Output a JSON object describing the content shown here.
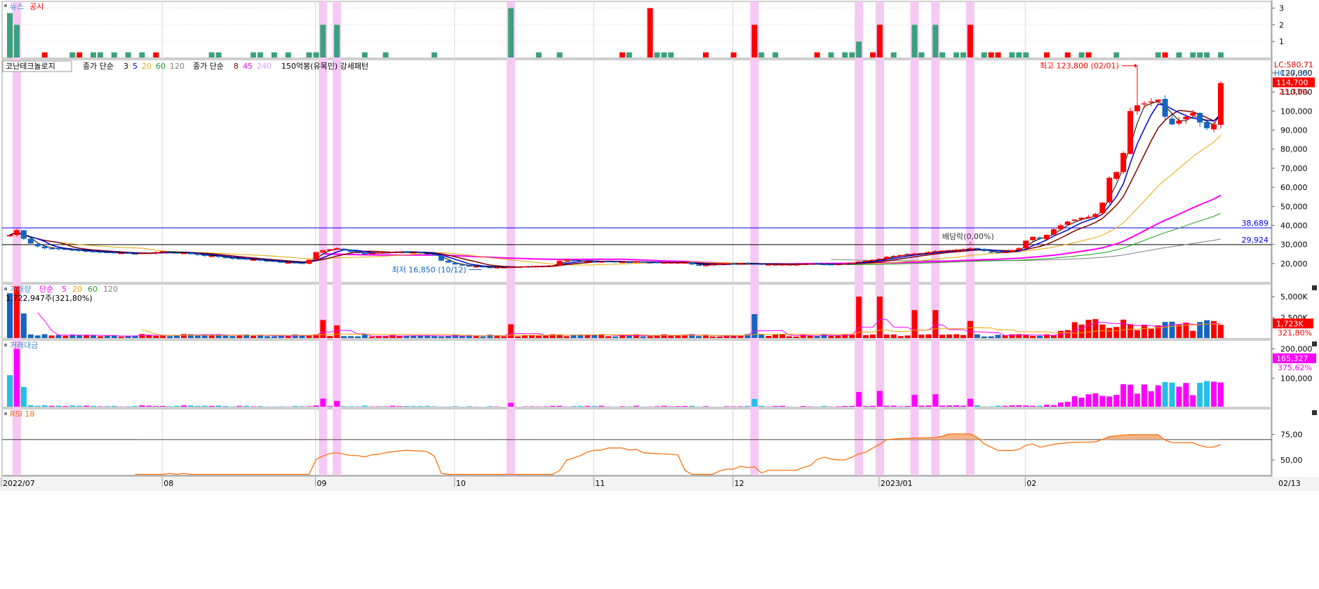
{
  "colors": {
    "up": "#ff0000",
    "down": "#1565c0",
    "news": "#3aa17e",
    "disclosure": "#ff0000",
    "highlight": "#f6c8f4",
    "ma3": "#000000",
    "ma5": "#0000cc",
    "ma20": "#e6a700",
    "ma60": "#1a9e1a",
    "ma120": "#808080",
    "maw8": "#800000",
    "maw45": "#ff00ff",
    "maw240": "#d8a0ff",
    "rsi": "#ff6a00",
    "rsi_fill": "#f3b48a",
    "amount_up": "#ff00ff",
    "amount_down": "#22c0e8",
    "hline": "#0000ff"
  },
  "panels": {
    "news": {
      "label_news": "뉴스",
      "label_disclosure": "공시",
      "ticks": [
        "3",
        "2",
        "1"
      ]
    },
    "price": {
      "legend": {
        "name": "코난테크놀로지",
        "close_simple": "종가 단순",
        "ma_periods": [
          "3",
          "5",
          "20",
          "60",
          "120"
        ],
        "close_simple2": "종가 단순",
        "ma_periods2": [
          "8",
          "45",
          "240"
        ],
        "pattern": "150억봉(유목민) 강세패턴"
      },
      "lc": "LC:580,71",
      "hc": "HC:-7,35",
      "current": "114,700",
      "current_pct": "23,33%",
      "max_label": "최고 123,800 (02/01)",
      "min_label": "최저 16,850 (10/12)",
      "div_label": "배당락(0,00%)",
      "hline1": "38,689",
      "hline2": "29,924",
      "ticks": [
        "120,000",
        "110,000",
        "100,000",
        "90,000",
        "80,000",
        "70,000",
        "60,000",
        "50,000",
        "40,000",
        "30,000",
        "20,000"
      ]
    },
    "volume": {
      "legend": {
        "name": "거래량",
        "simple": "단순",
        "periods": [
          "5",
          "20",
          "60",
          "120"
        ]
      },
      "info": "1,722,947주(321,80%)",
      "current": "1,723K",
      "current_pct": "321,80%",
      "ticks": [
        "5,000K",
        "2,500K"
      ]
    },
    "amount": {
      "legend": "거래대금",
      "current": "165,327",
      "current_pct": "375,62%",
      "ticks": [
        "200,000",
        "100,000"
      ]
    },
    "rsi": {
      "legend": "RSI 18",
      "ticks": [
        "75,00",
        "50,00"
      ]
    }
  },
  "xaxis": {
    "labels": [
      "2022/07",
      "08",
      "09",
      "10",
      "11",
      "12",
      "2023/01",
      "02",
      "02/13"
    ]
  },
  "chart_data": {
    "type": "candlestick",
    "title": "코난테크놀로지",
    "ylim": [
      10000,
      127000
    ],
    "y_ticks": [
      20000,
      30000,
      40000,
      50000,
      60000,
      70000,
      80000,
      90000,
      100000,
      110000,
      120000
    ],
    "period": "2022/07 – 2023/02",
    "close_approx": [
      35000,
      37500,
      33000,
      30500,
      29000,
      28000,
      28000,
      27500,
      27500,
      27000,
      26500,
      26500,
      26000,
      26000,
      25800,
      25500,
      25500,
      25200,
      25000,
      25500,
      25500,
      26000,
      26500,
      26000,
      25500,
      25500,
      25000,
      24500,
      24000,
      24000,
      23500,
      23000,
      22500,
      22500,
      22000,
      22000,
      21500,
      21200,
      21000,
      20500,
      20500,
      20200,
      20000,
      22000,
      26000,
      27000,
      27500,
      28000,
      27000,
      26000,
      25500,
      25000,
      25500,
      25800,
      26000,
      26200,
      26300,
      26000,
      25800,
      25500,
      25000,
      24500,
      21500,
      20500,
      19500,
      19000,
      18500,
      18500,
      18200,
      18000,
      18000,
      18000,
      18200,
      18300,
      18500,
      18600,
      18700,
      18800,
      19000,
      21500,
      22000,
      21500,
      21000,
      21200,
      21000,
      21000,
      21000,
      20800,
      20800,
      20500,
      21000,
      20500,
      20500,
      20500,
      20500,
      20500,
      20500,
      20500,
      19500,
      19000,
      19200,
      19500,
      19800,
      20000,
      20000,
      20200,
      20000,
      19800,
      19500,
      19500,
      19500,
      19500,
      19500,
      19500,
      19800,
      20000,
      19800,
      19500,
      19500,
      19700,
      20000,
      20500,
      21000,
      21500,
      22000,
      22500,
      23500,
      24000,
      24500,
      25000,
      25200,
      25500,
      26000,
      26500,
      26800,
      27000,
      27200,
      27500,
      28000,
      27500,
      26500,
      26000,
      25500,
      26000,
      27000,
      28000,
      32000,
      34000,
      33000,
      35000,
      38000,
      40000,
      42000,
      43000,
      44000,
      44500,
      46000,
      52000,
      65000,
      68000,
      78000,
      100000,
      103000,
      104000,
      105000,
      106000,
      97000,
      93000,
      95000,
      97000,
      99000,
      94000,
      91000,
      93000,
      114700
    ],
    "events": {
      "max": {
        "value": 123800,
        "date": "02/01"
      },
      "min": {
        "value": 16850,
        "date": "10/12"
      },
      "hlines": [
        38689,
        29924
      ]
    },
    "volume_last": "1,722,947",
    "amount_last": "165,327",
    "rsi_ticks": [
      50,
      75
    ]
  }
}
